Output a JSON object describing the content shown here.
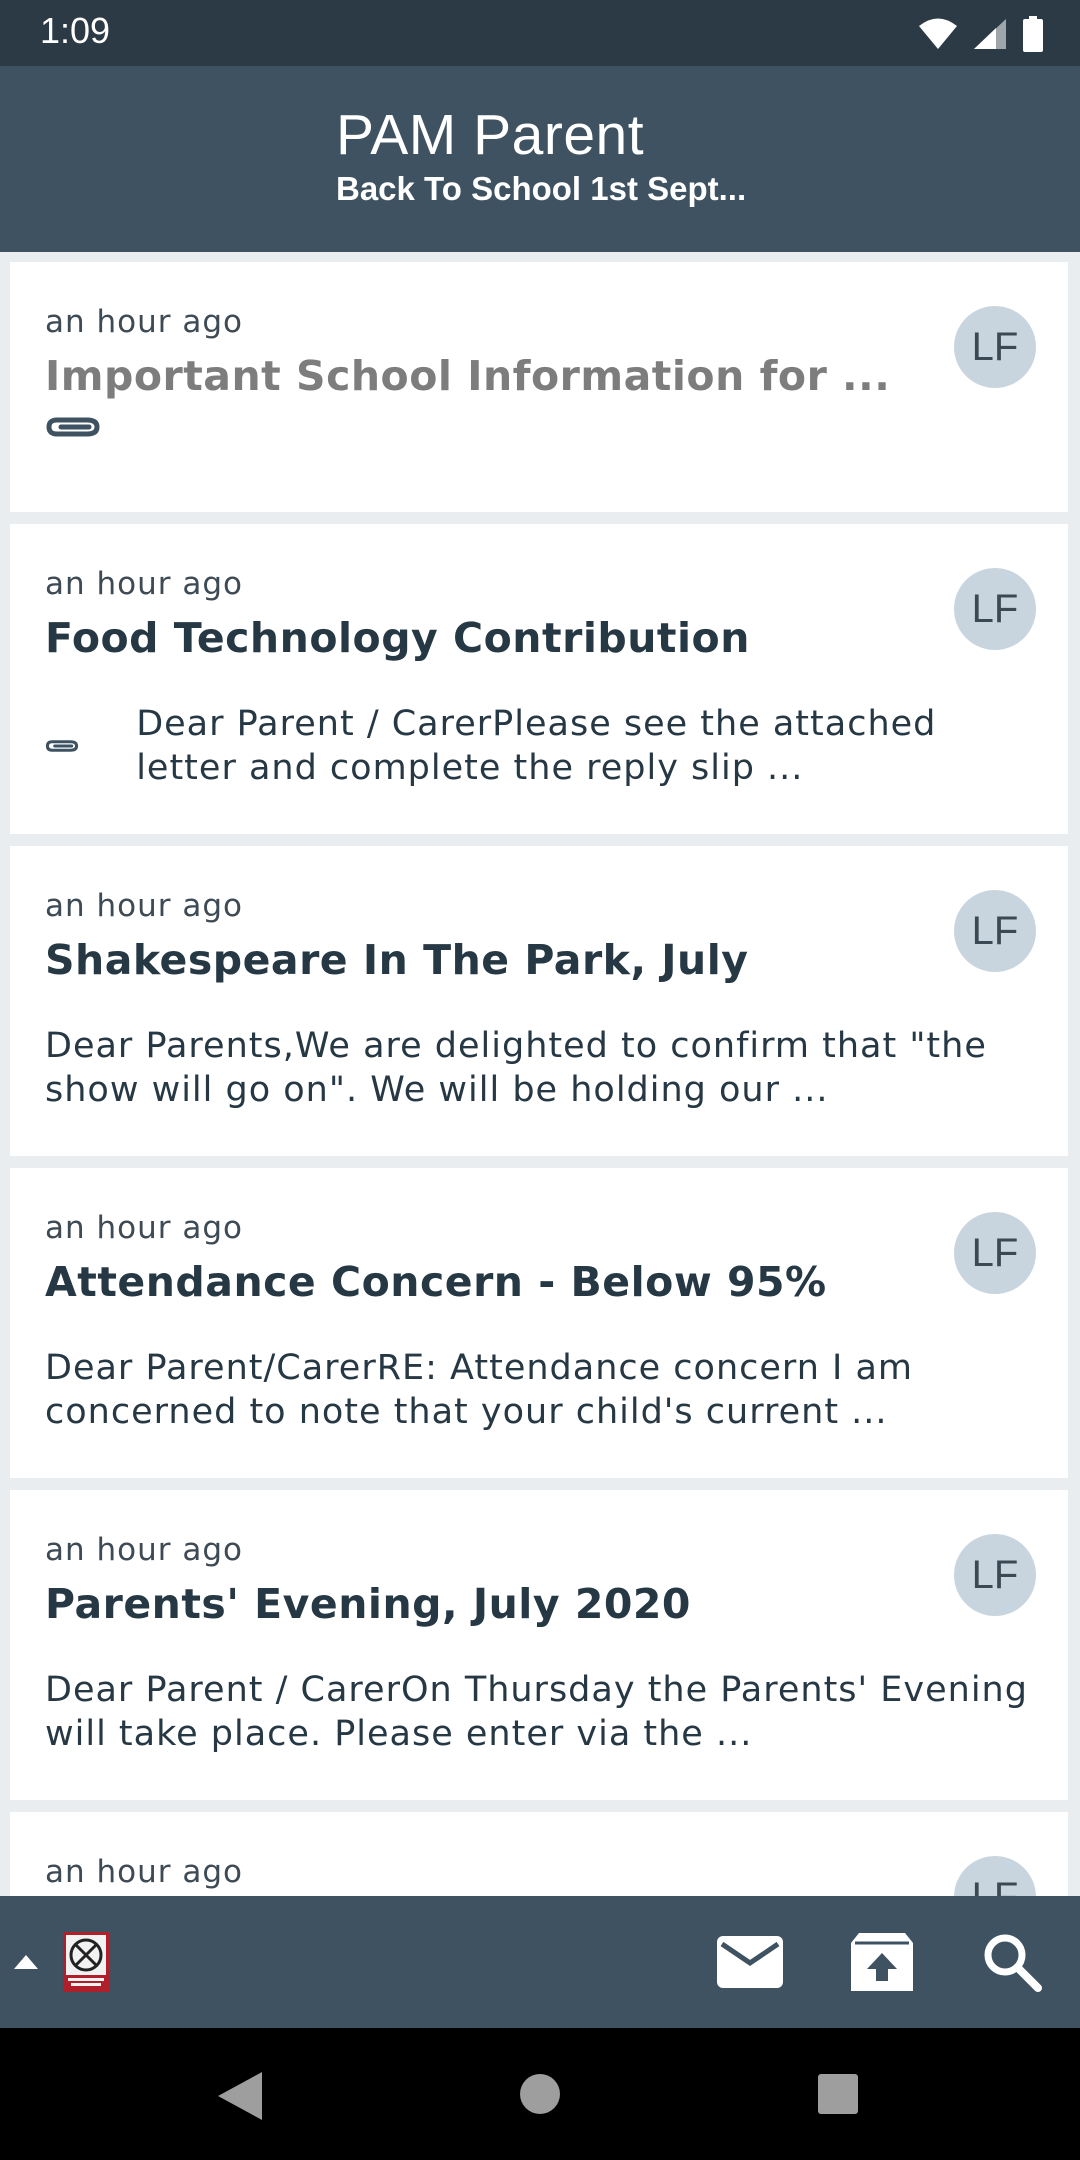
{
  "status_bar": {
    "time": "1:09"
  },
  "header": {
    "title": "PAM Parent",
    "subtitle": "Back To School 1st Sept..."
  },
  "messages": [
    {
      "time": "an hour ago",
      "title": "Important School Information for ...",
      "preview": "",
      "initials": "LF",
      "read": true,
      "attachment": true
    },
    {
      "time": "an hour ago",
      "title": "Food Technology Contribution",
      "preview": "Dear Parent / CarerPlease see the attached letter and complete the reply slip ...",
      "initials": "LF",
      "read": false,
      "attachment": true
    },
    {
      "time": "an hour ago",
      "title": "Shakespeare In The Park, July",
      "preview": "Dear Parents,We are delighted to confirm that \"the show will go on\". We will be holding our ...",
      "initials": "LF",
      "read": false,
      "attachment": false
    },
    {
      "time": "an hour ago",
      "title": "Attendance Concern - Below 95%",
      "preview": "Dear Parent/CarerRE: Attendance concern I am concerned to note that your child's current ...",
      "initials": "LF",
      "read": false,
      "attachment": false
    },
    {
      "time": "an hour ago",
      "title": "Parents' Evening, July 2020",
      "preview": "Dear Parent / CarerOn Thursday the Parents' Evening will take place. Please enter via the ...",
      "initials": "LF",
      "read": false,
      "attachment": false
    },
    {
      "time": "an hour ago",
      "title": "",
      "preview": "",
      "initials": "LF",
      "read": false,
      "attachment": false
    }
  ],
  "bottom_bar": {
    "expand_icon": "caret-up-icon",
    "logo_icon": "school-crest-logo",
    "actions": [
      "mail-icon",
      "archive-upload-icon",
      "search-icon"
    ]
  },
  "colors": {
    "header": "#3e5262",
    "status_bar": "#2c3a46",
    "avatar": "#c8d5df",
    "text": "#273845"
  }
}
